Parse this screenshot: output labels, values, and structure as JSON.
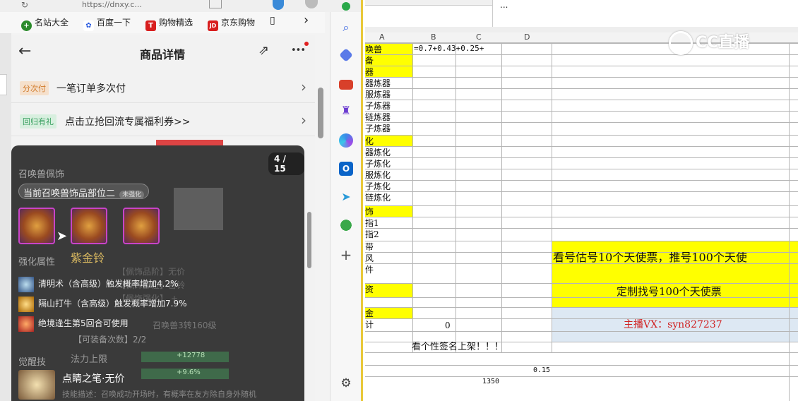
{
  "browser": {
    "url": "https://dnxy.c...",
    "bookmarks": [
      {
        "label": "名站大全",
        "icon": "site-nav-icon",
        "color": "#2a8a2a"
      },
      {
        "label": "百度一下",
        "icon": "baidu-paw-icon",
        "color": "#2a5adf"
      },
      {
        "label": "购物精选",
        "icon": "t-shop-icon",
        "color": "#d81e1e"
      },
      {
        "label": "京东购物",
        "icon": "jd-icon",
        "color": "#d81e1e"
      }
    ],
    "icons": {
      "refresh": "↻",
      "bookmark_more": "›",
      "doc": "▯"
    }
  },
  "product": {
    "title": "商品详情",
    "back": "←",
    "share": "⇗",
    "more": "•••",
    "rows": [
      {
        "tag": "分次付",
        "text": "一笔订单多次付"
      },
      {
        "tag": "回归有礼",
        "text": "点击立抢回流专属福利券>>"
      }
    ],
    "chev": "›"
  },
  "gallery": {
    "counter": "4 / 15",
    "section": "召唤兽佩饰",
    "slot_label": "当前召唤兽饰品部位二",
    "slot_badge": "未强化",
    "item_name": "紫金铃",
    "enh_title": "强化属性",
    "attrs": [
      "清明术（含高级）触发概率增加4.2%",
      "隔山打牛（含高级）触发概率增加7.9%",
      "绝境逢生第5回合可使用"
    ],
    "bg_lines": [
      "【佩饰品阶】无价",
      "【佩饰部位】兽铃",
      "【佩饰强化】 +...",
      "【可装备次数】2/2"
    ],
    "summon_req": "召唤兽3转160级",
    "mana_label": "法力上限",
    "mana_val": "+12778",
    "pct_val": "+9.6%",
    "awaken_title": "觉醒技",
    "skill_name": "点睛之笔·无价",
    "skill_desc": "技能描述：召唤成功开场时，有概率在友方除自身外随机"
  },
  "sidebar_icons": [
    "search-icon",
    "tag-icon",
    "briefcase-icon",
    "chess-icon",
    "copilot-icon",
    "outlook-icon",
    "send-icon",
    "tree-icon",
    "plus-icon",
    "settings-icon"
  ],
  "excel": {
    "columns": [
      "A",
      "B",
      "C",
      "D"
    ],
    "formula": "=0.7+0.43+0.25+",
    "col_a": [
      "唤兽",
      "备",
      "器",
      "器炼器",
      "服炼器",
      "子炼器",
      "链炼器",
      "子炼器",
      "化",
      "器炼化",
      "子炼化",
      "服炼化",
      "子炼化",
      "链炼化",
      "饰",
      "指1",
      "指2",
      "带",
      "风",
      "件",
      "资",
      "",
      "金",
      "计"
    ],
    "b_total": "0",
    "note": "看个性签名上架！！！",
    "d_val": "0.15",
    "c_val": "1350",
    "promo1": "看号估号10个天使票，推号100个天使",
    "promo2": "定制找号100个天使票",
    "promo3": "主播VX：syn827237",
    "top_text": "...",
    "watermark": "CC直播"
  }
}
